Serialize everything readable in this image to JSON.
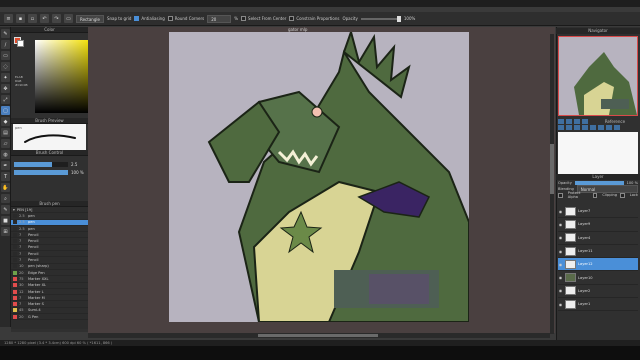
{
  "toolbar": {
    "shape_select": "Rectangle",
    "snap_label": "Snap to grid",
    "antialiasing_label": "Antialiasing",
    "round_corners_label": "Round Corners",
    "round_value": "20",
    "pct_symbol": "%",
    "select_from_center_label": "Select From Center",
    "constrain_label": "Constrain Proportions",
    "opacity_label": "Opacity",
    "opacity_value": "100%"
  },
  "canvas": {
    "filename": "gator mlp"
  },
  "color_panel": {
    "title": "Color",
    "values": [
      "ELAB",
      "RGB",
      "#C9C0B"
    ],
    "hex": "#C9C0B"
  },
  "brush_preview": {
    "title": "Brush Preview",
    "label": "pen"
  },
  "brush_control": {
    "title": "Brush Control",
    "size_value": "2.5",
    "size_fill": 0.7,
    "opacity_value": "100 %",
    "opacity_fill": 1.0
  },
  "brush_list": {
    "title": "Brush pen",
    "folder": "PEN [19]",
    "items": [
      {
        "num": "2.5",
        "name": "pen",
        "color": "#2a2a2a",
        "selected": false
      },
      {
        "num": "2.5",
        "name": "pen",
        "color": "#2a2a2a",
        "selected": true
      },
      {
        "num": "2.5",
        "name": "pen",
        "color": "#2a2a2a",
        "selected": false
      },
      {
        "num": "7",
        "name": "Pencil",
        "color": "#2a2a2a",
        "selected": false
      },
      {
        "num": "7",
        "name": "Pencil",
        "color": "#2a2a2a",
        "selected": false
      },
      {
        "num": "7",
        "name": "Pencil",
        "color": "#2a2a2a",
        "selected": false
      },
      {
        "num": "7",
        "name": "Pencil",
        "color": "#2a2a2a",
        "selected": false
      },
      {
        "num": "7",
        "name": "Pencil",
        "color": "#2a2a2a",
        "selected": false
      },
      {
        "num": "10",
        "name": "pen (sharp)",
        "color": "#2a2a2a",
        "selected": false
      },
      {
        "num": "20",
        "name": "Edge Pen",
        "color": "#6fa24b",
        "selected": false
      },
      {
        "num": "75",
        "name": "Marker XXL",
        "color": "#e04c4c",
        "selected": false
      },
      {
        "num": "30",
        "name": "Marker XL",
        "color": "#e04c4c",
        "selected": false
      },
      {
        "num": "12",
        "name": "Marker L",
        "color": "#e04c4c",
        "selected": false
      },
      {
        "num": "7",
        "name": "Marker M",
        "color": "#e04c4c",
        "selected": false
      },
      {
        "num": "7",
        "name": "Marker S",
        "color": "#e04c4c",
        "selected": false
      },
      {
        "num": "45",
        "name": "Sumi-4",
        "color": "#e0c04c",
        "selected": false
      },
      {
        "num": "20",
        "name": "G Pen",
        "color": "#e04c4c",
        "selected": false
      }
    ]
  },
  "navigator": {
    "title": "Navigator"
  },
  "reference": {
    "title": "Reference"
  },
  "layer_panel": {
    "title": "Layer",
    "opacity_label": "Opacity",
    "opacity_value": "100 %",
    "blending_label": "Blending",
    "blending_value": "Normal",
    "protect_alpha_label": "Protect Alpha",
    "clipping_label": "Clipping",
    "lock_label": "Lock",
    "layers": [
      {
        "name": "Layer7",
        "selected": false,
        "dark": false
      },
      {
        "name": "Layer9",
        "selected": false,
        "dark": false
      },
      {
        "name": "Layer4",
        "selected": false,
        "dark": false
      },
      {
        "name": "Layer11",
        "selected": false,
        "dark": false
      },
      {
        "name": "Layer12",
        "selected": true,
        "dark": false
      },
      {
        "name": "Layer10",
        "selected": false,
        "dark": true
      },
      {
        "name": "Layer2",
        "selected": false,
        "dark": false
      },
      {
        "name": "Layer1",
        "selected": false,
        "dark": false
      }
    ]
  },
  "status": {
    "text": "1280 * 1280 pixel   (3.4 * 3.4cm)   600 dpi   60 %   (  *1611, 866 )"
  }
}
